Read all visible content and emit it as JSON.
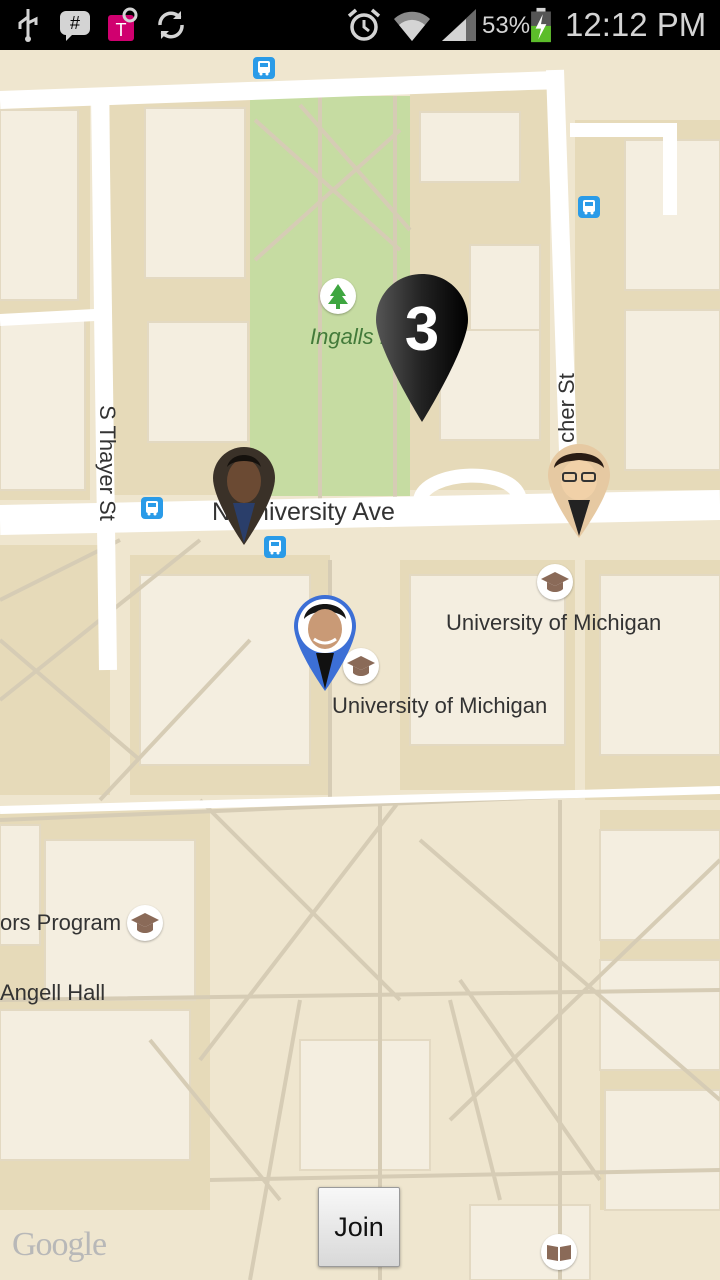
{
  "status_bar": {
    "battery_percent": "53%",
    "time": "12:12 PM",
    "icons": [
      "usb-icon",
      "messaging-icon",
      "carrier-icon",
      "sync-icon",
      "alarm-icon",
      "wifi-icon",
      "signal-icon",
      "battery-icon"
    ]
  },
  "map": {
    "streets": {
      "thayer": "S Thayer St",
      "university": "N University Ave",
      "fletcher": "cher St"
    },
    "places": {
      "ingalls": "Ingalls M",
      "umich_1": "University of Michigan",
      "umich_2": "University of Michigan",
      "honors": "ors Program",
      "angell": "Angell Hall"
    },
    "cluster_count": "3",
    "attribution": "Google",
    "colors": {
      "land": "#efe6cf",
      "block": "#e5d9b9",
      "building": "#f4efe3",
      "road": "#ffffff",
      "park": "#c4dca0",
      "transit": "#2a9be8"
    }
  },
  "controls": {
    "join_label": "Join"
  }
}
